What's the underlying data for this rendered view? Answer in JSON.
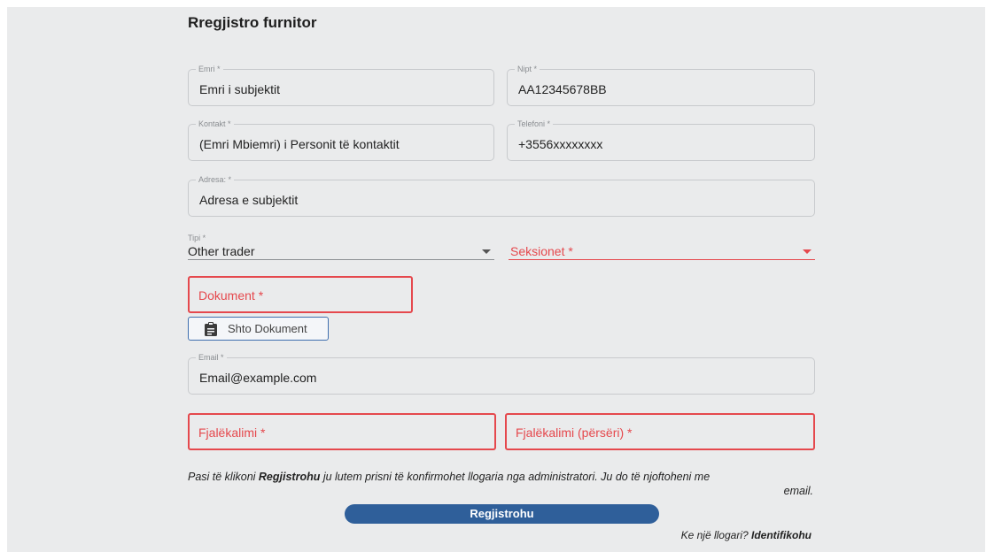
{
  "form": {
    "title": "Rregjistro furnitor",
    "name": {
      "label": "Emri *",
      "value": "Emri i subjektit"
    },
    "nipt": {
      "label": "Nipt *",
      "value": "AA12345678BB"
    },
    "contact": {
      "label": "Kontakt *",
      "value": "(Emri Mbiemri) i Personit të kontaktit"
    },
    "phone": {
      "label": "Telefoni *",
      "value": "+3556xxxxxxxx"
    },
    "address": {
      "label": "Adresa: *",
      "value": "Adresa e subjektit"
    },
    "type": {
      "label": "Tipi *",
      "value": "Other trader"
    },
    "sections": {
      "placeholder": "Seksionet *"
    },
    "document": {
      "placeholder": "Dokument *"
    },
    "add_document_label": "Shto Dokument",
    "email": {
      "label": "Email *",
      "value": "Email@example.com"
    },
    "password": {
      "placeholder": "Fjalëkalimi *"
    },
    "password_repeat": {
      "placeholder": "Fjalëkalimi (përsëri) *"
    },
    "note_pre": "Pasi të klikoni ",
    "note_bold": "Regjistrohu",
    "note_post": " ju lutem prisni të konfirmohet llogaria nga administratori. Ju do të njoftoheni me",
    "note_line2": "email.",
    "submit_label": "Regjistrohu",
    "login_prompt": "Ke një llogari? ",
    "login_link": "Identifikohu"
  },
  "colors": {
    "error": "#e5484d",
    "primary": "#2f5f9a",
    "panel_bg": "#eaebec"
  },
  "icons": {
    "document": "clipboard-icon",
    "dropdown": "caret-down-icon"
  }
}
